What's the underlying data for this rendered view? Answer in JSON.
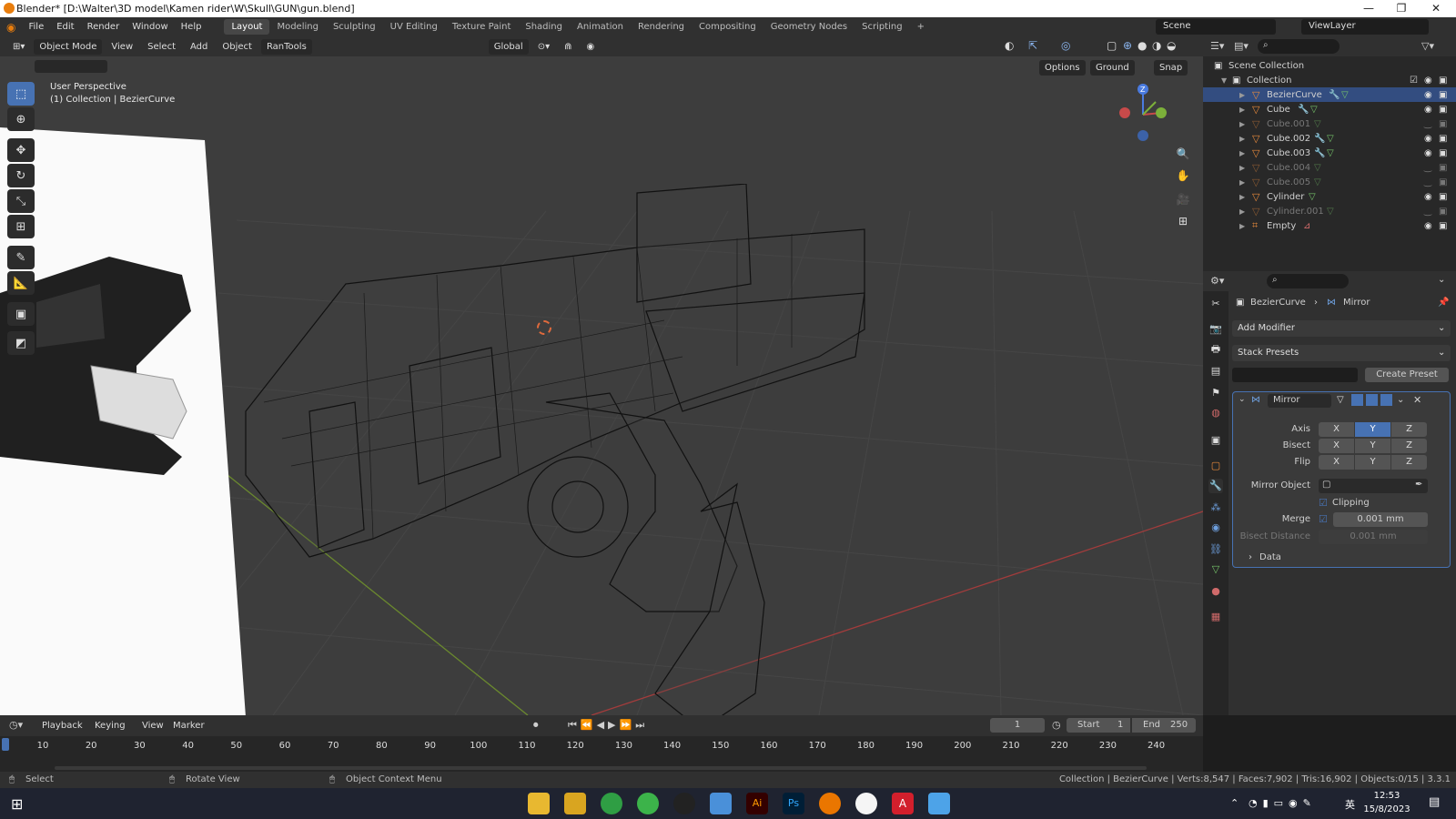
{
  "window": {
    "title": "Blender* [D:\\Walter\\3D model\\Kamen rider\\W\\Skull\\GUN\\gun.blend]"
  },
  "menu": {
    "items": [
      "File",
      "Edit",
      "Render",
      "Window",
      "Help"
    ]
  },
  "workspaces": [
    "Layout",
    "Modeling",
    "Sculpting",
    "UV Editing",
    "Texture Paint",
    "Shading",
    "Animation",
    "Rendering",
    "Compositing",
    "Geometry Nodes",
    "Scripting"
  ],
  "workspace_add": "+",
  "top_right": {
    "scene": "Scene",
    "view_layer": "ViewLayer"
  },
  "viewport_header": {
    "mode": "Object Mode",
    "menus": [
      "View",
      "Select",
      "Add",
      "Object"
    ],
    "addon": "RanTools",
    "orientation": "Global",
    "options": "Options",
    "ground": "Ground",
    "snap": "Snap"
  },
  "viewport": {
    "perspective": "User Perspective",
    "collection": "(1) Collection | BezierCurve",
    "gizmo": {
      "z": "Z",
      "y": "Y",
      "x": "X"
    }
  },
  "outliner": {
    "root": "Scene Collection",
    "collection": "Collection",
    "items": [
      {
        "name": "BezierCurve",
        "visible": true
      },
      {
        "name": "Cube",
        "visible": true
      },
      {
        "name": "Cube.001",
        "visible": false
      },
      {
        "name": "Cube.002",
        "visible": true
      },
      {
        "name": "Cube.003",
        "visible": true
      },
      {
        "name": "Cube.004",
        "visible": false
      },
      {
        "name": "Cube.005",
        "visible": false
      },
      {
        "name": "Cylinder",
        "visible": true
      },
      {
        "name": "Cylinder.001",
        "visible": false
      },
      {
        "name": "Empty",
        "visible": true
      }
    ]
  },
  "properties": {
    "breadcrumb_object": "BezierCurve",
    "breadcrumb_modifier": "Mirror",
    "add_modifier": "Add Modifier",
    "stack_presets": "Stack Presets",
    "create_preset": "Create Preset",
    "modifier_name": "Mirror",
    "axis_label": "Axis",
    "bisect_label": "Bisect",
    "flip_label": "Flip",
    "axes": [
      "X",
      "Y",
      "Z"
    ],
    "mirror_object_label": "Mirror Object",
    "clipping_label": "Clipping",
    "merge_label": "Merge",
    "merge_value": "0.001 mm",
    "bisect_distance_label": "Bisect Distance",
    "bisect_distance_value": "0.001 mm",
    "data_label": "Data"
  },
  "timeline": {
    "menus": [
      "Playback",
      "Keying",
      "View",
      "Marker"
    ],
    "current_frame": "1",
    "start_label": "Start",
    "start": "1",
    "end_label": "End",
    "end": "250",
    "ticks": [
      "10",
      "20",
      "30",
      "40",
      "50",
      "60",
      "70",
      "80",
      "90",
      "100",
      "110",
      "120",
      "130",
      "140",
      "150",
      "160",
      "170",
      "180",
      "190",
      "200",
      "210",
      "220",
      "230",
      "240"
    ]
  },
  "status": {
    "select": "Select",
    "rotate": "Rotate View",
    "context": "Object Context Menu",
    "stats": "Collection | BezierCurve | Verts:8,547 | Faces:7,902 | Tris:16,902 | Objects:0/15 | 3.3.1"
  },
  "taskbar": {
    "time": "12:53",
    "date": "15/8/2023",
    "ime": "英"
  }
}
